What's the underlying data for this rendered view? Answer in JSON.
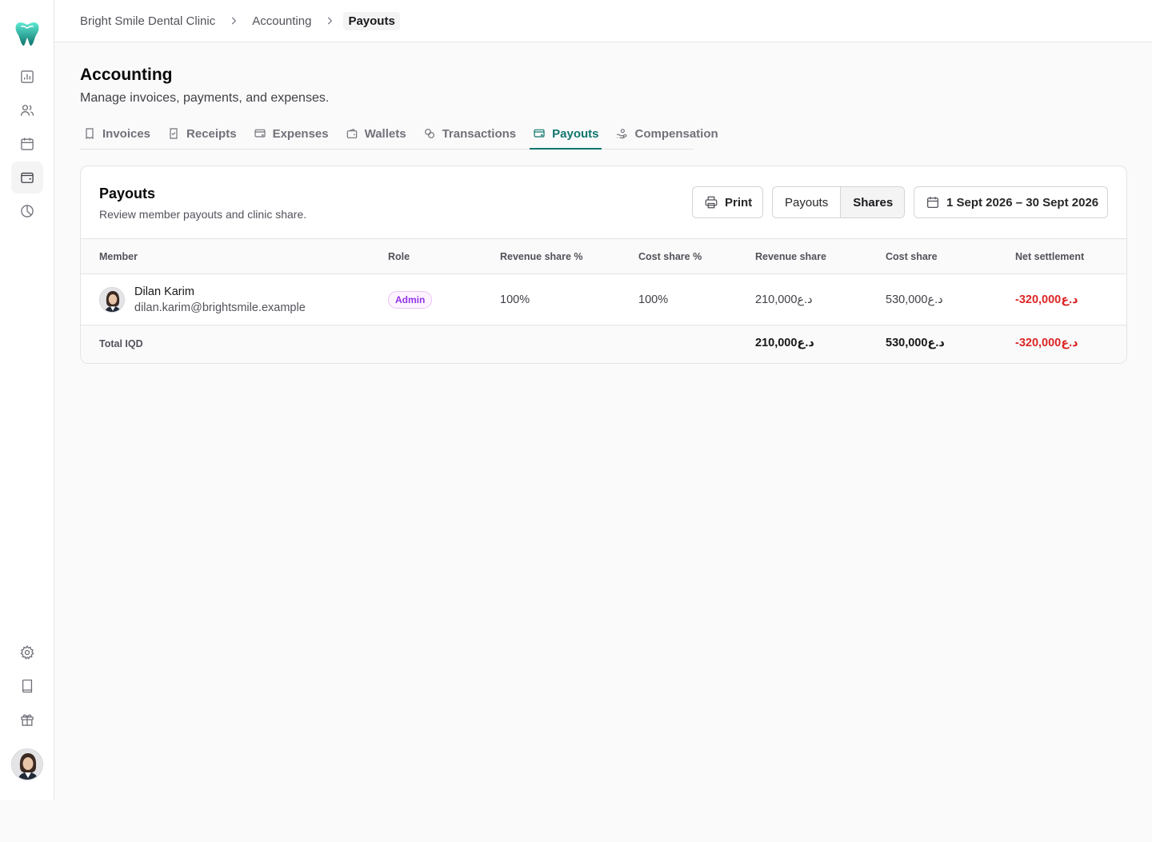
{
  "app": {
    "accent": "#0f766e",
    "negative": "#dc2626"
  },
  "sidebar": {
    "items": [
      {
        "icon": "chart-icon"
      },
      {
        "icon": "users-icon"
      },
      {
        "icon": "calendar-icon"
      },
      {
        "icon": "wallet-icon",
        "active": true
      },
      {
        "icon": "pie-chart-icon"
      }
    ],
    "bottom": [
      {
        "icon": "gear-icon"
      },
      {
        "icon": "book-icon"
      },
      {
        "icon": "gift-icon"
      }
    ]
  },
  "breadcrumb": [
    "Bright Smile Dental Clinic",
    "Accounting",
    "Payouts"
  ],
  "page": {
    "title": "Accounting",
    "subtitle": "Manage invoices, payments, and expenses."
  },
  "tabs": [
    {
      "label": "Invoices",
      "icon": "invoice-icon"
    },
    {
      "label": "Receipts",
      "icon": "receipt-icon"
    },
    {
      "label": "Expenses",
      "icon": "expenses-icon"
    },
    {
      "label": "Wallets",
      "icon": "wallet-icon"
    },
    {
      "label": "Transactions",
      "icon": "transactions-icon"
    },
    {
      "label": "Payouts",
      "icon": "payouts-icon",
      "active": true
    },
    {
      "label": "Compensation",
      "icon": "compensation-icon"
    }
  ],
  "card": {
    "title": "Payouts",
    "subtitle": "Review member payouts and clinic share.",
    "print_label": "Print",
    "toggle": {
      "payouts": "Payouts",
      "shares": "Shares",
      "selected": "Shares"
    },
    "date_range": "1 Sept 2026 – 30 Sept 2026"
  },
  "table": {
    "columns": [
      "Member",
      "Role",
      "Revenue share %",
      "Cost share %",
      "Revenue share",
      "Cost share",
      "Net settlement"
    ],
    "rows": [
      {
        "name": "Dilan Karim",
        "email": "dilan.karim@brightsmile.example",
        "role": "Admin",
        "revenue_share_pct": "100%",
        "cost_share_pct": "100%",
        "revenue_share": "210,000د.ع",
        "cost_share": "530,000د.ع",
        "net_settlement": "-320,000د.ع"
      }
    ],
    "total": {
      "label": "Total IQD",
      "revenue_share": "210,000د.ع",
      "cost_share": "530,000د.ع",
      "net_settlement": "-320,000د.ع"
    }
  }
}
